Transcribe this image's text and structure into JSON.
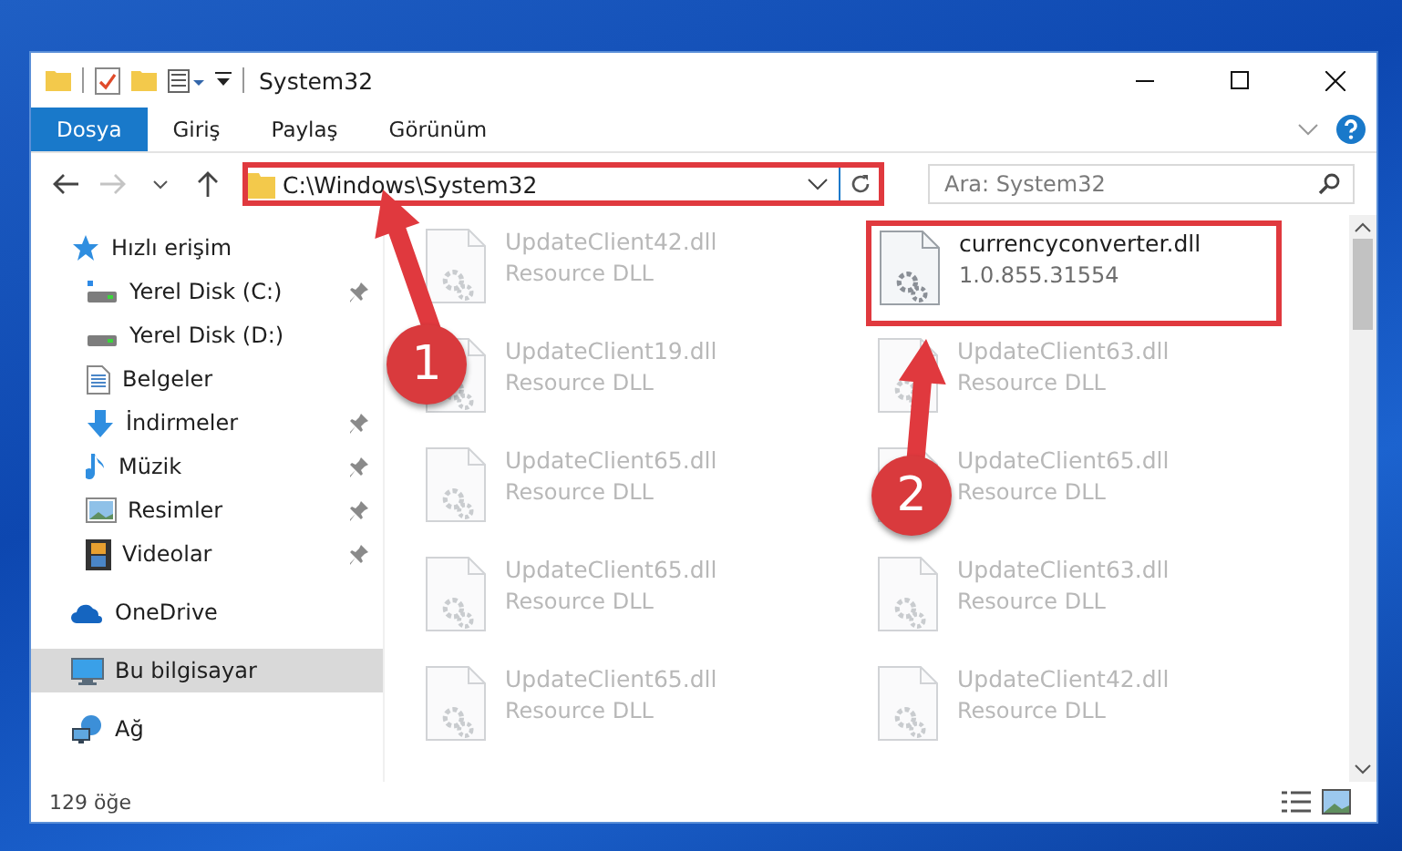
{
  "window": {
    "title": "System32"
  },
  "ribbon": {
    "tabs": [
      {
        "label": "Dosya",
        "selected": true
      },
      {
        "label": "Giriş",
        "selected": false
      },
      {
        "label": "Paylaş",
        "selected": false
      },
      {
        "label": "Görünüm",
        "selected": false
      }
    ]
  },
  "address": {
    "path": "C:\\Windows\\System32",
    "highlighted": true
  },
  "search": {
    "placeholder": "Ara: System32"
  },
  "sidebar": {
    "items": [
      {
        "label": "Hızlı erişim",
        "kind": "star",
        "selected": false,
        "children": [
          {
            "label": "Yerel Disk (C:)",
            "kind": "drive-c",
            "pinned": true,
            "selected": false
          },
          {
            "label": "Yerel Disk (D:)",
            "kind": "drive",
            "pinned": false,
            "selected": false
          },
          {
            "label": "Belgeler",
            "kind": "docs",
            "pinned": false,
            "selected": false
          },
          {
            "label": "İndirmeler",
            "kind": "download",
            "pinned": true,
            "selected": false
          },
          {
            "label": "Müzik",
            "kind": "music",
            "pinned": true,
            "selected": false
          },
          {
            "label": "Resimler",
            "kind": "pictures",
            "pinned": true,
            "selected": false
          },
          {
            "label": "Videolar",
            "kind": "videos",
            "pinned": true,
            "selected": false
          }
        ]
      },
      {
        "label": "OneDrive",
        "kind": "cloud",
        "selected": false
      },
      {
        "label": "Bu bilgisayar",
        "kind": "pc",
        "selected": true
      },
      {
        "label": "Ağ",
        "kind": "network",
        "selected": false
      }
    ]
  },
  "files": [
    {
      "name": "UpdateClient42.dll",
      "detail": "Resource DLL",
      "highlighted": false,
      "blurred": true
    },
    {
      "name": "currencyconverter.dll",
      "detail": "1.0.855.31554",
      "highlighted": true,
      "blurred": false
    },
    {
      "name": "UpdateClient19.dll",
      "detail": "Resource DLL",
      "highlighted": false,
      "blurred": true
    },
    {
      "name": "UpdateClient63.dll",
      "detail": "Resource DLL",
      "highlighted": false,
      "blurred": true
    },
    {
      "name": "UpdateClient65.dll",
      "detail": "Resource DLL",
      "highlighted": false,
      "blurred": true
    },
    {
      "name": "UpdateClient65.dll",
      "detail": "Resource DLL",
      "highlighted": false,
      "blurred": true
    },
    {
      "name": "UpdateClient65.dll",
      "detail": "Resource DLL",
      "highlighted": false,
      "blurred": true
    },
    {
      "name": "UpdateClient63.dll",
      "detail": "Resource DLL",
      "highlighted": false,
      "blurred": true
    },
    {
      "name": "UpdateClient65.dll",
      "detail": "Resource DLL",
      "highlighted": false,
      "blurred": true
    },
    {
      "name": "UpdateClient42.dll",
      "detail": "Resource DLL",
      "highlighted": false,
      "blurred": true
    }
  ],
  "status_bar": {
    "count": "129 öğe"
  },
  "callouts": [
    {
      "number": "1"
    },
    {
      "number": "2"
    }
  ]
}
